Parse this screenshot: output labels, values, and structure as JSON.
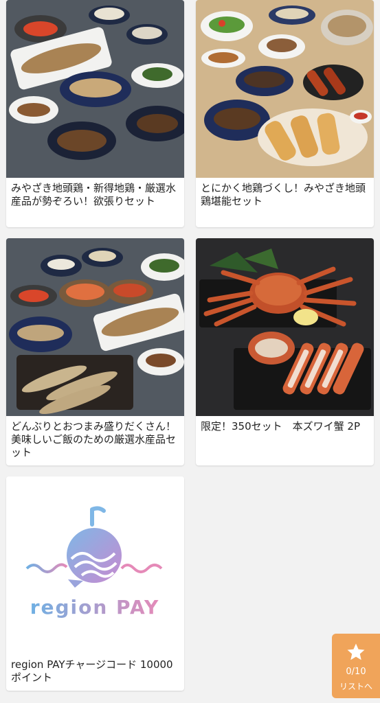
{
  "products": [
    {
      "title": "みやざき地頭鶏・新得地鶏・厳選水産品が勢ぞろい！欲張りセット",
      "image": "assorted-chicken-fish-set-photo"
    },
    {
      "title": "とにかく地鶏づくし！みやざき地頭鶏堪能セット",
      "image": "chicken-dishes-set-photo"
    },
    {
      "title": "どんぶりとおつまみ盛りだくさん！美味しいご飯のための厳選水産品セット",
      "image": "seafood-bowl-set-photo"
    },
    {
      "title": "限定！350セット　本ズワイ蟹 2P",
      "image": "snow-crab-photo"
    },
    {
      "title": "region PAYチャージコード 10000ポイント",
      "image": "region-pay-logo"
    }
  ],
  "logo": {
    "text": "region PAY"
  },
  "favorites": {
    "count": "0/10",
    "label": "リストへ",
    "icon": "star-icon"
  },
  "colors": {
    "accent": "#f0a45a",
    "logo_gradient_start": "#7fb7e6",
    "logo_gradient_end": "#e58ab8"
  }
}
